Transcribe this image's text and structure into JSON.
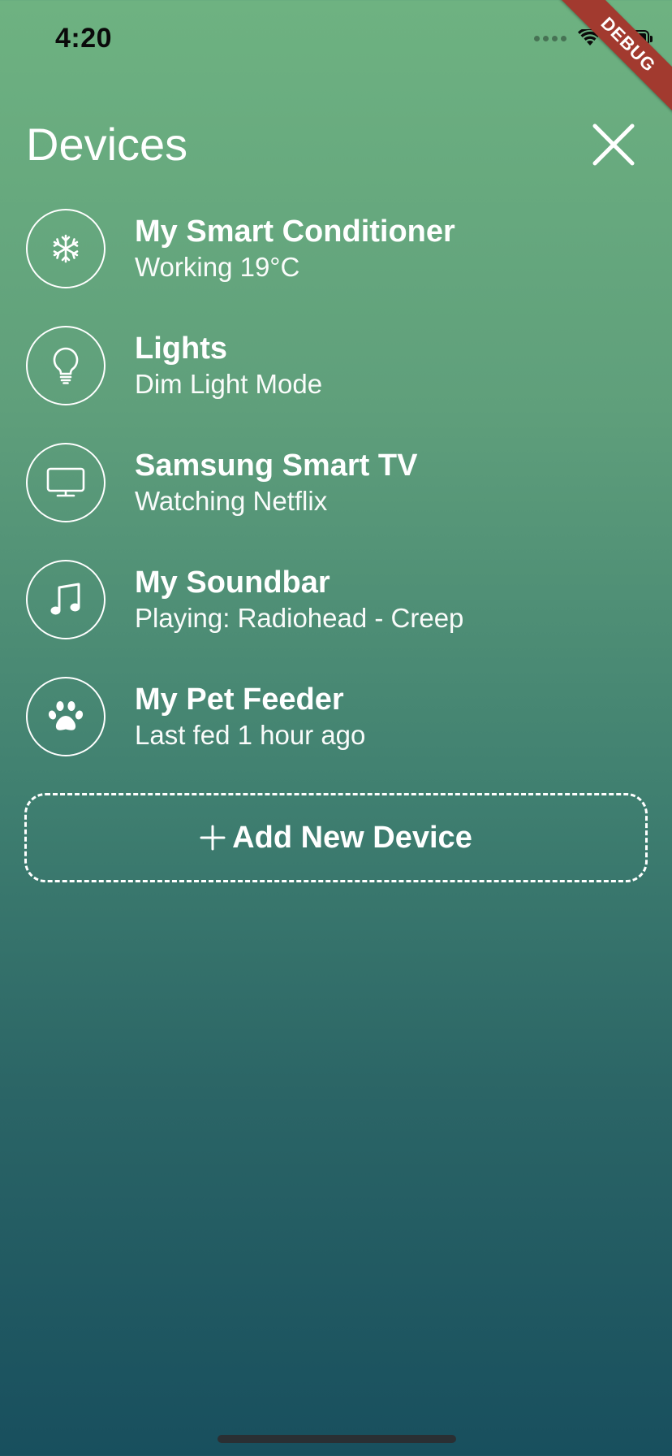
{
  "status_bar": {
    "time": "4:20",
    "icons": [
      "cellular-dots-icon",
      "wifi-icon",
      "battery-icon"
    ]
  },
  "debug_banner": {
    "label": "DEBUG"
  },
  "header": {
    "title": "Devices",
    "close_icon": "close-icon"
  },
  "devices": [
    {
      "name": "My Smart Conditioner",
      "status": "Working 19°C",
      "icon": "snowflake-icon"
    },
    {
      "name": "Lights",
      "status": "Dim Light Mode",
      "icon": "lightbulb-icon"
    },
    {
      "name": "Samsung Smart TV",
      "status": "Watching Netflix",
      "icon": "tv-icon"
    },
    {
      "name": "My Soundbar",
      "status": "Playing: Radiohead - Creep",
      "icon": "music-note-icon"
    },
    {
      "name": "My Pet Feeder",
      "status": "Last fed 1 hour ago",
      "icon": "paw-icon"
    }
  ],
  "add_device": {
    "label": "Add New Device",
    "icon": "plus-icon"
  },
  "colors": {
    "gradient_top": "#6eb281",
    "gradient_bottom": "#184f5e",
    "text": "#ffffff",
    "debug_ribbon": "#a23a2f"
  }
}
